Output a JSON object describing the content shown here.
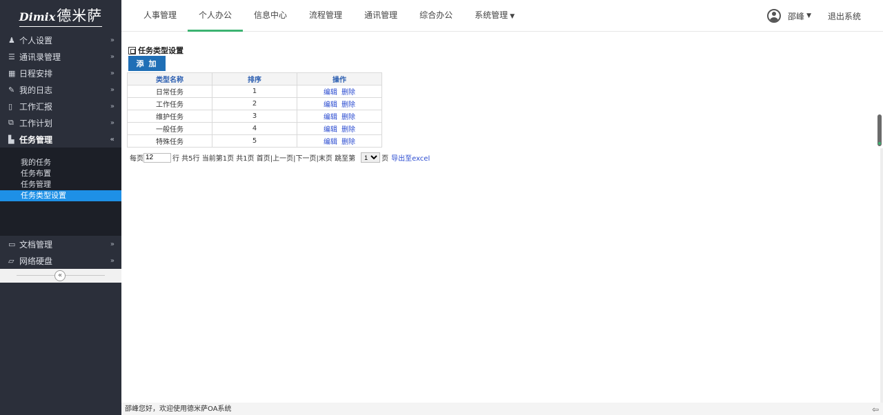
{
  "logo": {
    "en": "Dimix",
    "cn": "德米萨"
  },
  "topnav": {
    "tabs": [
      {
        "label": "人事管理"
      },
      {
        "label": "个人办公"
      },
      {
        "label": "信息中心"
      },
      {
        "label": "流程管理"
      },
      {
        "label": "通讯管理"
      },
      {
        "label": "综合办公"
      },
      {
        "label": "系统管理"
      }
    ],
    "active_tab": "个人办公",
    "user_name": "邵峰",
    "logout_label": "退出系统"
  },
  "sidebar": {
    "items": [
      {
        "icon": "person-icon",
        "label": "个人设置"
      },
      {
        "icon": "list-icon",
        "label": "通讯录管理"
      },
      {
        "icon": "calendar-icon",
        "label": "日程安排"
      },
      {
        "icon": "pencil-icon",
        "label": "我的日志"
      },
      {
        "icon": "document-icon",
        "label": "工作汇报"
      },
      {
        "icon": "copy-icon",
        "label": "工作计划"
      },
      {
        "icon": "task-icon",
        "label": "任务管理"
      },
      {
        "icon": "folder-icon",
        "label": "文档管理"
      },
      {
        "icon": "folder-open-icon",
        "label": "网络硬盘"
      }
    ],
    "submenu": [
      {
        "label": "我的任务"
      },
      {
        "label": "任务布置"
      },
      {
        "label": "任务管理"
      },
      {
        "label": "任务类型设置"
      }
    ],
    "active_item": "任务管理",
    "active_sub": "任务类型设置"
  },
  "main": {
    "title": "任务类型设置",
    "add_label": "添 加",
    "table": {
      "headers": [
        "类型名称",
        "排序",
        "操作"
      ],
      "rows": [
        {
          "name": "日常任务",
          "order": "1"
        },
        {
          "name": "工作任务",
          "order": "2"
        },
        {
          "name": "维护任务",
          "order": "3"
        },
        {
          "name": "一般任务",
          "order": "4"
        },
        {
          "name": "特殊任务",
          "order": "5"
        }
      ],
      "edit_label": "编辑",
      "delete_label": "删除"
    },
    "pager": {
      "per_page_prefix": "每页",
      "per_page_value": "12",
      "summary": "行 共5行  当前第1页  共1页  首页|上一页|下一页|末页  跳至第",
      "page_options": [
        "1"
      ],
      "page_suffix": "页",
      "export_label": "导出至excel"
    }
  },
  "footer": {
    "text": "邵峰您好，欢迎使用德米萨OA系统"
  },
  "colors": {
    "sidebar_bg": "#2b2f3a",
    "active_sub": "#1e90e6",
    "tab_underline": "#3cb371",
    "button": "#1f6fb6"
  }
}
